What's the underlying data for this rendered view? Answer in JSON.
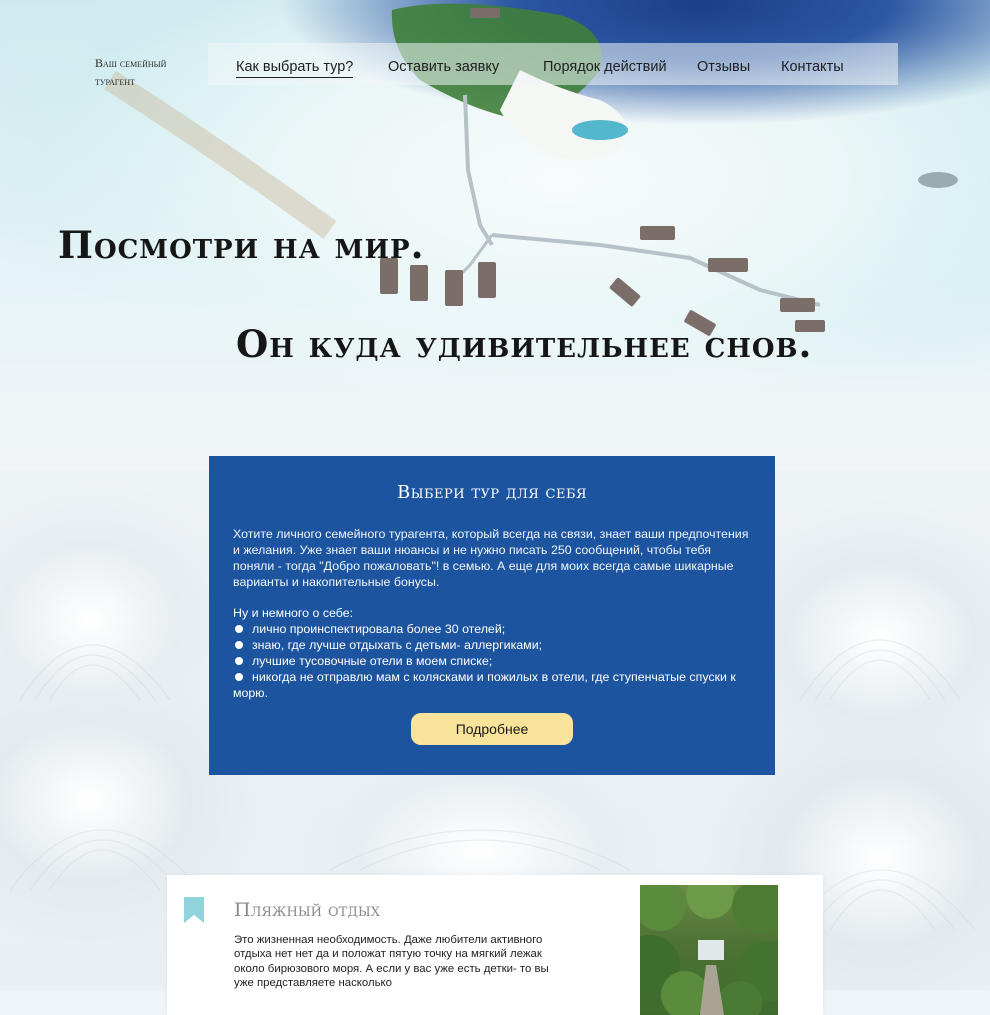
{
  "logo": {
    "line1": "Ваш семейный",
    "line2": "турагент"
  },
  "nav": {
    "items": [
      {
        "label": "Как выбрать тур?",
        "active": true
      },
      {
        "label": "Оставить заявку",
        "active": false
      },
      {
        "label": "Порядок действий",
        "active": false
      },
      {
        "label": "Отзывы",
        "active": false
      },
      {
        "label": "Контакты",
        "active": false
      }
    ]
  },
  "hero": {
    "line1": "Посмотри на мир.",
    "line2": "Он куда удивительнее снов."
  },
  "card": {
    "title": "Выбери тур для себя",
    "text": "Хотите личного семейного турагента, который всегда на связи, знает ваши предпочтения и желания. Уже знает ваши нюансы и не нужно писать 250 сообщений, чтобы тебя поняли - тогда \"Добро пожаловать\"! в семью. А еще для моих всегда самые шикарные варианты и накопительные бонусы.",
    "subtitle": "Ну и немного о себе:",
    "list": [
      "лично проинспектировала более 30 отелей;",
      "знаю, где лучше отдыхать с детьми- аллергиками;",
      "лучшие тусовочные отели  в моем списке;",
      "никогда не отправлю мам с колясками и пожилых в отели, где ступенчатые спуски к морю."
    ],
    "button": "Подробнее"
  },
  "beach": {
    "title": "Пляжный отдых",
    "text": "Это жизненная необходимость. Даже любители активного отдыха нет нет да и положат пятую точку на мягкий лежак около бирюзового моря. А если у вас уже есть детки- то вы уже представляете насколько"
  },
  "colors": {
    "card_bg": "#1c54a0",
    "button_bg": "#f7e39a",
    "bookmark": "#8fd3dc"
  }
}
